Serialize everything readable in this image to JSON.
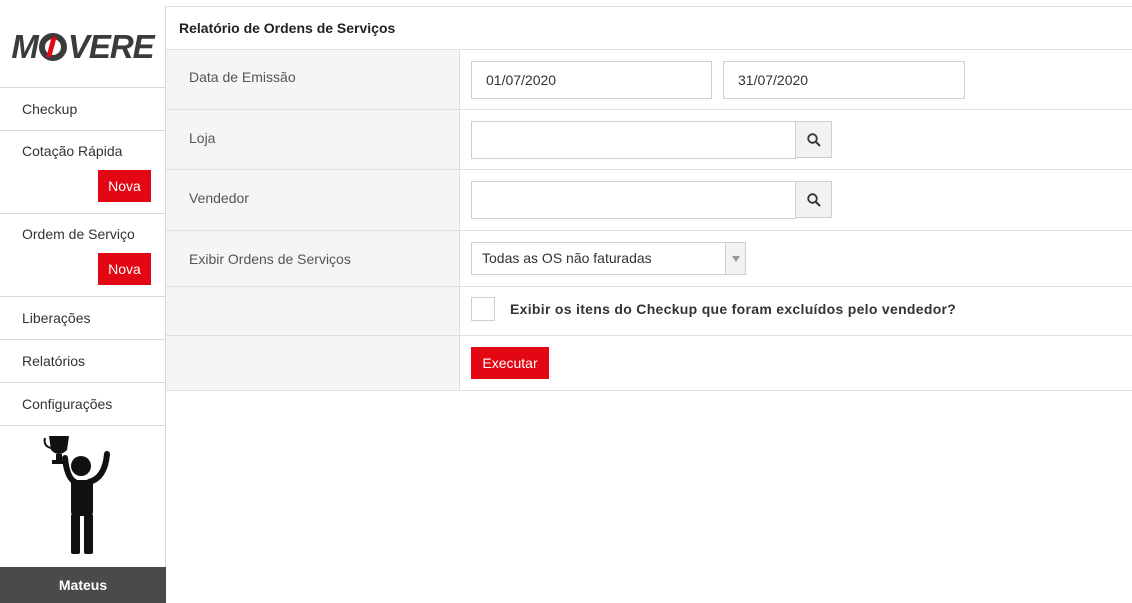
{
  "sidebar": {
    "logo_left": "M",
    "logo_right": "VERE",
    "items": [
      {
        "label": "Checkup"
      },
      {
        "label": "Cotação Rápida",
        "badge": "Nova"
      },
      {
        "label": "Ordem de Serviço",
        "badge": "Nova"
      },
      {
        "label": "Liberações"
      },
      {
        "label": "Relatórios"
      },
      {
        "label": "Configurações"
      }
    ],
    "user_name": "Mateus"
  },
  "main": {
    "title": "Relatório de Ordens de Serviços",
    "fields": {
      "data_emissao": {
        "label": "Data de Emissão",
        "start": "01/07/2020",
        "end": "31/07/2020"
      },
      "loja": {
        "label": "Loja",
        "value": ""
      },
      "vendedor": {
        "label": "Vendedor",
        "value": ""
      },
      "exibir_os": {
        "label": "Exibir Ordens de Serviços",
        "selected": "Todas as OS não faturadas"
      },
      "checkup_excluidos": {
        "label": "Exibir os itens do Checkup que foram excluídos pelo vendedor?",
        "checked": false
      }
    },
    "execute_label": "Executar"
  },
  "colors": {
    "accent": "#e30613",
    "user_bar": "#4a4a4a",
    "label_bg": "#f5f5f5"
  },
  "icons": {
    "search": "search-icon",
    "dropdown": "caret-down-icon"
  }
}
